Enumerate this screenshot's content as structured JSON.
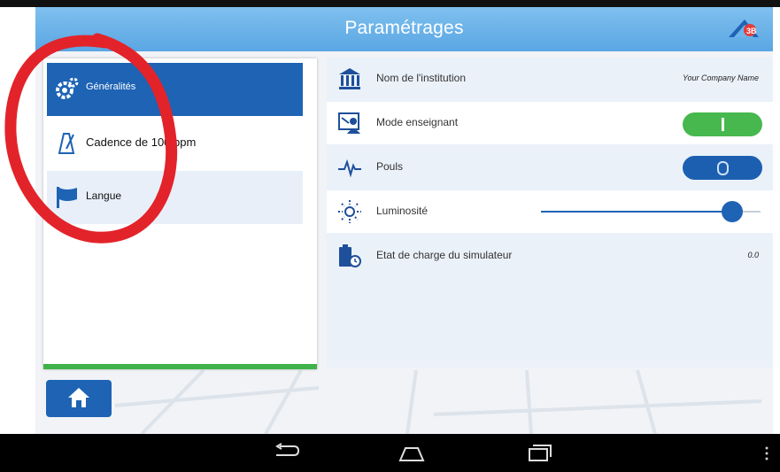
{
  "app": {
    "title": "Paramétrages",
    "accent": "#1e63b4",
    "appbar_color": "#6db4ea"
  },
  "sidebar": {
    "items": [
      {
        "label": "Généralités",
        "icon": "gear-icon",
        "active": true
      },
      {
        "label": "Cadence de 100 bpm",
        "icon": "metronome-icon",
        "active": false
      },
      {
        "label": "Langue",
        "icon": "flag-icon",
        "active": false
      }
    ]
  },
  "settings": {
    "institution": {
      "label": "Nom de l'institution",
      "value": "Your Company Name",
      "icon": "institution-icon"
    },
    "teacher_mode": {
      "label": "Mode enseignant",
      "state": "on",
      "icon": "teacher-icon"
    },
    "pulse": {
      "label": "Pouls",
      "state": "off",
      "icon": "pulse-icon"
    },
    "brightness": {
      "label": "Luminosité",
      "level": 0.88,
      "icon": "brightness-icon"
    },
    "battery": {
      "label": "Etat de charge du simulateur",
      "value": "0.0",
      "icon": "battery-icon"
    }
  },
  "footer": {
    "home_icon": "home-icon"
  },
  "system_nav": {
    "back": "back-icon",
    "home": "home-nav-icon",
    "recents": "recents-icon",
    "menu": "menu-dots-icon"
  }
}
